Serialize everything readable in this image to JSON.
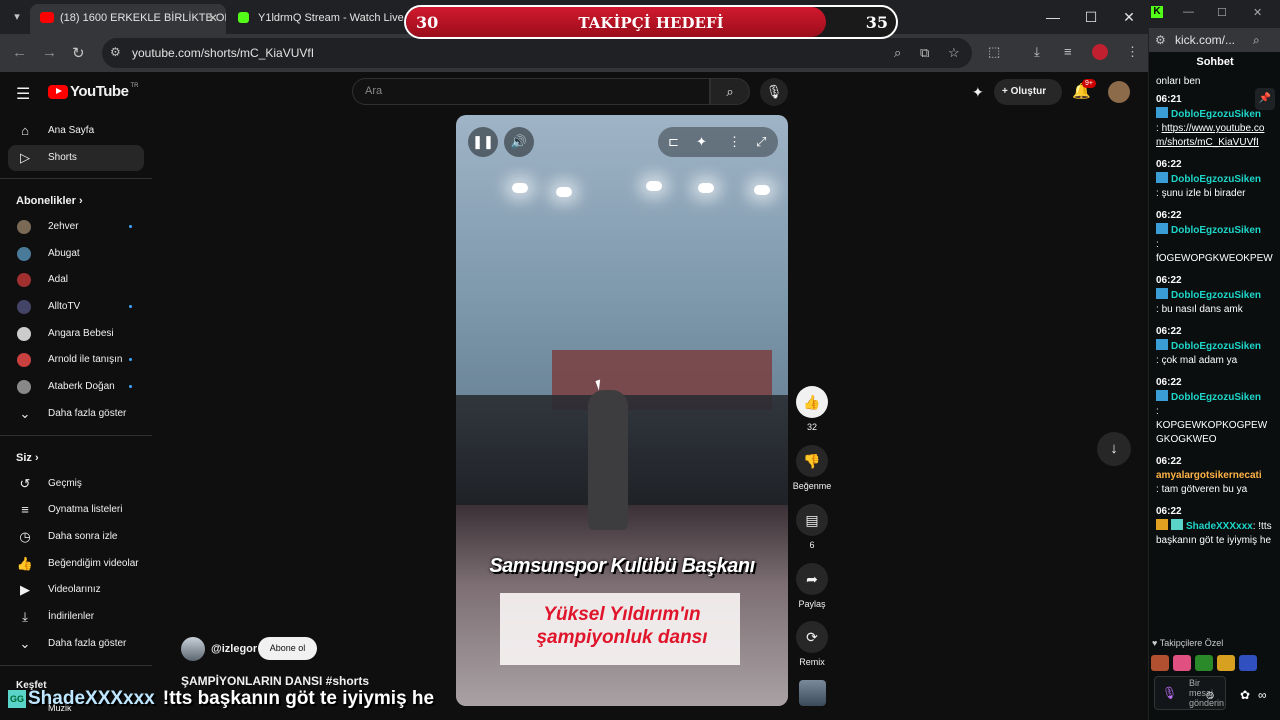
{
  "browser": {
    "tabs": [
      {
        "label": "(18) 1600 ERKEKLE BİRLİKTE OL",
        "favicon_color": "#ff0000"
      },
      {
        "label": "Y1ldrmQ Stream - Watch Live o",
        "favicon_color": "#53fc18"
      }
    ],
    "url": "youtube.com/shorts/mC_KiaVUVfI"
  },
  "youtube": {
    "logo_text": "YouTube",
    "logo_sup": "TR",
    "search_placeholder": "Ara",
    "create_label": "Oluştur",
    "notif_count": "9+"
  },
  "sidebar": {
    "main": [
      {
        "label": "Ana Sayfa",
        "icon": "home-icon"
      },
      {
        "label": "Shorts",
        "icon": "shorts-icon"
      }
    ],
    "subs_header": "Abonelikler",
    "subs": [
      {
        "label": "2ehver",
        "color": "#7a6a55",
        "live": true
      },
      {
        "label": "Abugat",
        "color": "#4a7a9a",
        "live": false
      },
      {
        "label": "Adal",
        "color": "#a03030",
        "live": false
      },
      {
        "label": "AlltoTV",
        "color": "#444466",
        "live": true
      },
      {
        "label": "Angara Bebesi",
        "color": "#cccccc",
        "live": false
      },
      {
        "label": "Arnold ile tanışın",
        "color": "#c84040",
        "live": true
      },
      {
        "label": "Ataberk Doğan",
        "color": "#888888",
        "live": true
      }
    ],
    "subs_more": "Daha fazla göster",
    "you_header": "Siz",
    "you": [
      {
        "label": "Geçmiş",
        "icon": "history-icon"
      },
      {
        "label": "Oynatma listeleri",
        "icon": "playlist-icon"
      },
      {
        "label": "Daha sonra izle",
        "icon": "clock-icon"
      },
      {
        "label": "Beğendiğim videolar",
        "icon": "thumb-icon"
      },
      {
        "label": "Videolarınız",
        "icon": "video-icon"
      },
      {
        "label": "İndirilenler",
        "icon": "download-icon"
      }
    ],
    "you_more": "Daha fazla göster",
    "explore_header": "Keşfet",
    "explore_first": "Müzik"
  },
  "short": {
    "caption_top": "Samsunspor Kulübü Başkanı",
    "caption_bottom_1": "Yüksel Yıldırım'ın",
    "caption_bottom_2": "şampiyonluk dansı",
    "channel": "@izlegor",
    "subscribe_label": "Abone ol",
    "title": "ŞAMPİYONLARIN DANSI #shorts"
  },
  "actions": {
    "likes": "32",
    "dislike_label": "Beğenme",
    "comments": "6",
    "share_label": "Paylaş",
    "remix_label": "Remix"
  },
  "overlay": {
    "goal_title": "TAKİPÇİ HEDEFİ",
    "goal_current": "30",
    "goal_target": "35",
    "goal_progress": 0.857,
    "chat_badge": "GG",
    "chat_user": "ShadeXXXxxx",
    "chat_message": "!tts başkanın göt te iyiymiş he"
  },
  "kick": {
    "url": "kick.com/...",
    "header": "Sohbet",
    "clipped_top": "onları ben",
    "messages": [
      {
        "time": "06:21",
        "user": "DobloEgzozuSiken",
        "text": "https://www.youtube.com/shorts/mC_KiaVUVfI",
        "link": true
      },
      {
        "time": "06:22",
        "user": "DobloEgzozuSiken",
        "text": "şunu izle bi birader"
      },
      {
        "time": "06:22",
        "user": "DobloEgzozuSiken",
        "text": "fOGEWOPGKWEOKPEW"
      },
      {
        "time": "06:22",
        "user": "DobloEgzozuSiken",
        "text": "bu nasıl dans amk"
      },
      {
        "time": "06:22",
        "user": "DobloEgzozuSiken",
        "text": "çok mal adam ya"
      },
      {
        "time": "06:22",
        "user": "DobloEgzozuSiken",
        "text": "KOPGEWKOPKOGPEWGKOGKWEO"
      },
      {
        "time": "06:22",
        "user": "amyalargotsikernecati",
        "text": "tam götveren bu ya",
        "orange": true
      },
      {
        "time": "06:22",
        "user": "ShadeXXXxxx",
        "text": "!tts başkanın göt te iyiymiş he"
      }
    ],
    "followers_label": "Takipçilere Özel",
    "input_placeholder": "Bir mesaj gönderin"
  }
}
